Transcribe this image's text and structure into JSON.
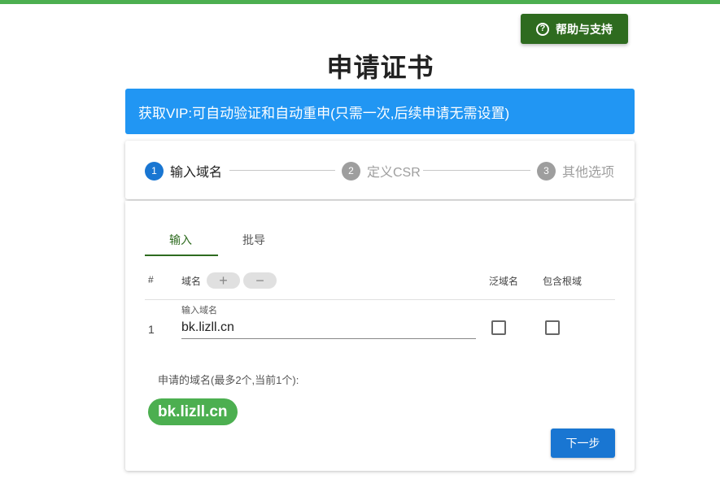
{
  "header": {
    "help_label": "帮助与支持",
    "title": "申请证书"
  },
  "banner": {
    "text": "获取VIP:可自动验证和自动重申(只需一次,后续申请无需设置)"
  },
  "stepper": {
    "steps": [
      {
        "num": "1",
        "label": "输入域名"
      },
      {
        "num": "2",
        "label": "定义CSR"
      },
      {
        "num": "3",
        "label": "其他选项"
      }
    ]
  },
  "tabs": [
    {
      "label": "输入"
    },
    {
      "label": "批导"
    }
  ],
  "table": {
    "headers": {
      "index": "#",
      "domain": "域名",
      "add": "+",
      "remove": "−",
      "wildcard": "泛域名",
      "include_root": "包含根域"
    },
    "rows": [
      {
        "index": "1",
        "field_label": "输入域名",
        "value": "bk.lizll.cn"
      }
    ]
  },
  "applied": {
    "label": "申请的域名(最多2个,当前1个):",
    "chips": [
      "bk.lizll.cn"
    ]
  },
  "actions": {
    "next_label": "下一步"
  },
  "colors": {
    "accent_green": "#4caf50",
    "dark_green": "#2e6b1f",
    "banner_blue": "#2196f3",
    "primary_blue": "#1976d2"
  },
  "icons": {
    "help": "help-circle-icon"
  }
}
